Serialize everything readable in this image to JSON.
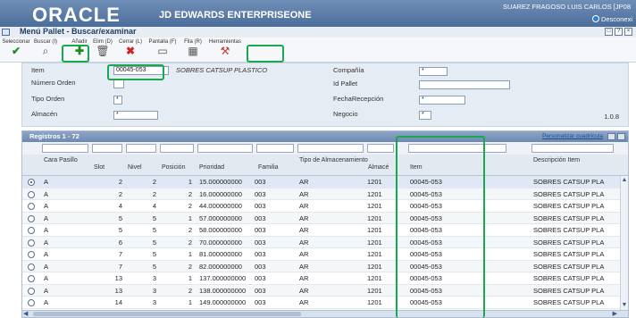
{
  "brand": {
    "logo": "ORACLE",
    "suffix": "JD EDWARDS ENTERPRISEONE",
    "user": "SUAREZ FRAGOSO LUIS CARLOS [JP08",
    "logout": "Desconexi"
  },
  "title": "Menú Pallet - Buscar/examinar",
  "window_buttons": [
    "□",
    "?",
    "×"
  ],
  "toolbar": {
    "select": "Seleccionar",
    "search": "Buscar (I)",
    "add": "Añadir",
    "delete": "Elim (D)",
    "close": "Cerrar (L)",
    "screen": "Pantalla (F)",
    "row": "Fila (R)",
    "tools": "Herramientas"
  },
  "form": {
    "item_label": "Item",
    "item_value": "00045-053",
    "item_desc": "SOBRES CATSUP PLASTICO",
    "order_number_label": "Número Orden",
    "order_number_value": "",
    "order_type_label": "Tipo Orden",
    "order_type_value": "*",
    "warehouse_label": "Almacén",
    "warehouse_value": "*",
    "company_label": "Compañía",
    "company_value": "*",
    "pallet_id_label": "Id Pallet",
    "pallet_id_value": "",
    "receipt_date_label": "FechaRecepción",
    "receipt_date_value": "*",
    "business_label": "Negocio",
    "business_value": "*",
    "version": "1.0.8"
  },
  "grid": {
    "title": "Registros 1 - 72",
    "customize": "Personalizar cuadrícula",
    "columns": {
      "face": "Cara Pasillo",
      "slot": "Slot",
      "level": "Nivel",
      "position": "Posición",
      "priority": "Prioridad",
      "family": "Familia",
      "storage_type": "Tipo de Almacenamiento",
      "warehouse": "Almacé",
      "item": "Item",
      "description": "Descripción Item"
    },
    "rows": [
      {
        "face": "A",
        "slot": "2",
        "level": "2",
        "position": "1",
        "priority": "15.000000000",
        "family": "003",
        "storage": "AR",
        "warehouse": "1201",
        "item": "00045-053",
        "desc": "SOBRES CATSUP PLA",
        "selected": true
      },
      {
        "face": "A",
        "slot": "2",
        "level": "2",
        "position": "2",
        "priority": "16.000000000",
        "family": "003",
        "storage": "AR",
        "warehouse": "1201",
        "item": "00045-053",
        "desc": "SOBRES CATSUP PLA",
        "selected": false
      },
      {
        "face": "A",
        "slot": "4",
        "level": "4",
        "position": "2",
        "priority": "44.000000000",
        "family": "003",
        "storage": "AR",
        "warehouse": "1201",
        "item": "00045-053",
        "desc": "SOBRES CATSUP PLA",
        "selected": false
      },
      {
        "face": "A",
        "slot": "5",
        "level": "5",
        "position": "1",
        "priority": "57.000000000",
        "family": "003",
        "storage": "AR",
        "warehouse": "1201",
        "item": "00045-053",
        "desc": "SOBRES CATSUP PLA",
        "selected": false
      },
      {
        "face": "A",
        "slot": "5",
        "level": "5",
        "position": "2",
        "priority": "58.000000000",
        "family": "003",
        "storage": "AR",
        "warehouse": "1201",
        "item": "00045-053",
        "desc": "SOBRES CATSUP PLA",
        "selected": false
      },
      {
        "face": "A",
        "slot": "6",
        "level": "5",
        "position": "2",
        "priority": "70.000000000",
        "family": "003",
        "storage": "AR",
        "warehouse": "1201",
        "item": "00045-053",
        "desc": "SOBRES CATSUP PLA",
        "selected": false
      },
      {
        "face": "A",
        "slot": "7",
        "level": "5",
        "position": "1",
        "priority": "81.000000000",
        "family": "003",
        "storage": "AR",
        "warehouse": "1201",
        "item": "00045-053",
        "desc": "SOBRES CATSUP PLA",
        "selected": false
      },
      {
        "face": "A",
        "slot": "7",
        "level": "5",
        "position": "2",
        "priority": "82.000000000",
        "family": "003",
        "storage": "AR",
        "warehouse": "1201",
        "item": "00045-053",
        "desc": "SOBRES CATSUP PLA",
        "selected": false
      },
      {
        "face": "A",
        "slot": "13",
        "level": "3",
        "position": "1",
        "priority": "137.000000000",
        "family": "003",
        "storage": "AR",
        "warehouse": "1201",
        "item": "00045-053",
        "desc": "SOBRES CATSUP PLA",
        "selected": false
      },
      {
        "face": "A",
        "slot": "13",
        "level": "3",
        "position": "2",
        "priority": "138.000000000",
        "family": "003",
        "storage": "AR",
        "warehouse": "1201",
        "item": "00045-053",
        "desc": "SOBRES CATSUP PLA",
        "selected": false
      },
      {
        "face": "A",
        "slot": "14",
        "level": "3",
        "position": "1",
        "priority": "149.000000000",
        "family": "003",
        "storage": "AR",
        "warehouse": "1201",
        "item": "00045-053",
        "desc": "SOBRES CATSUP PLA",
        "selected": false
      }
    ]
  },
  "colors": {
    "brand_bar": "#5a7aa6",
    "highlight": "#18a84e",
    "grid_header": "#7f98bb"
  }
}
